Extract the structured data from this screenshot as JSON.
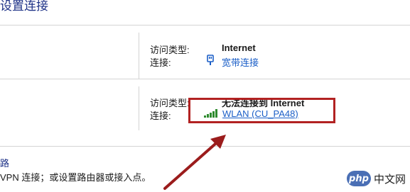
{
  "header": {
    "title": "设置连接"
  },
  "connection_1": {
    "access_type_label": "访问类型:",
    "access_type_value": "Internet",
    "connection_label": "连接:",
    "connection_link": "宽带连接",
    "icon": "ethernet-plug-icon"
  },
  "connection_2": {
    "access_type_label": "访问类型:",
    "access_type_value": "无法连接到 Internet",
    "connection_label": "连接:",
    "connection_link": "WLAN (CU_PA48)",
    "icon": "wifi-signal-icon",
    "highlight_color": "#b22222"
  },
  "setup": {
    "heading": "路",
    "description": "VPN 连接；或设置路由器或接入点。"
  },
  "watermark": {
    "logo": "php",
    "text": "中文网"
  }
}
